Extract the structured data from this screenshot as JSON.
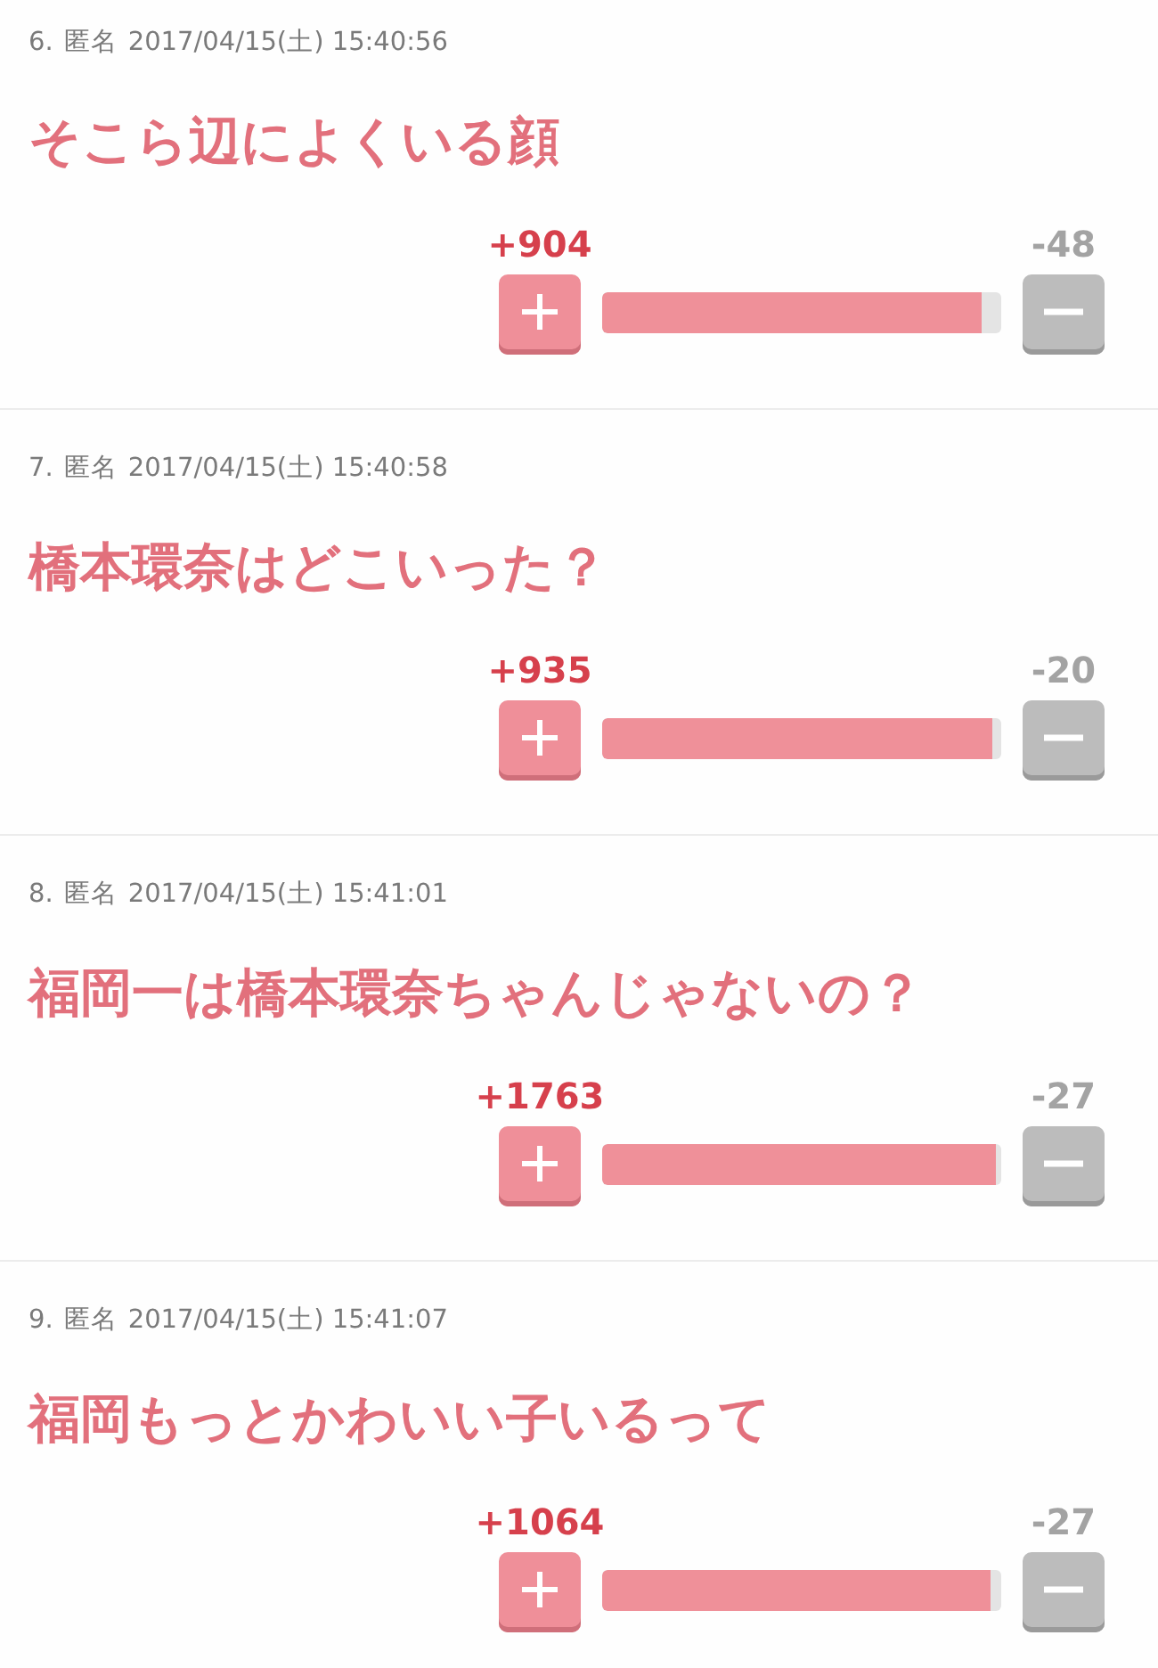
{
  "comments": [
    {
      "number": "6.",
      "author": "匿名",
      "date": "2017/04/15(土) 15:40:56",
      "body": "そこら辺によくいる顔",
      "vote": {
        "plus": "+904",
        "minus": "-48",
        "level": 0.95
      }
    },
    {
      "number": "7.",
      "author": "匿名",
      "date": "2017/04/15(土) 15:40:58",
      "body": "橋本環奈はどこいった？",
      "vote": {
        "plus": "+935",
        "minus": "-20",
        "level": 0.979
      }
    },
    {
      "number": "8.",
      "author": "匿名",
      "date": "2017/04/15(土) 15:41:01",
      "body": "福岡一は橋本環奈ちゃんじゃないの？",
      "vote": {
        "plus": "+1763",
        "minus": "-27",
        "level": 0.985
      }
    },
    {
      "number": "9.",
      "author": "匿名",
      "date": "2017/04/15(土) 15:41:07",
      "body": "福岡もっとかわいい子いるって",
      "vote": {
        "plus": "+1064",
        "minus": "-27",
        "level": 0.975
      }
    }
  ]
}
